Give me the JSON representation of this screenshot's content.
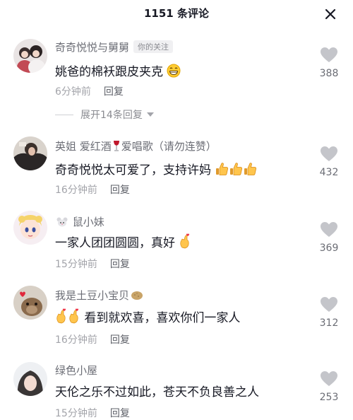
{
  "header": {
    "title": "1151 条评论"
  },
  "expand_label": "展开14条回复",
  "reply_label": "回复",
  "author_tag": "你的关注",
  "comments": [
    {
      "user": "奇奇悦悦与舅舅",
      "text": "姚爸的棉袄跟皮夹克",
      "time": "6分钟前",
      "likes": "388",
      "emojis": [
        "grin-emoji"
      ]
    },
    {
      "user_a": "英姐 爱红酒",
      "user_b": "爱唱歌（请勿连赞）",
      "text": "奇奇悦悦太可爱了，支持许妈",
      "time": "16分钟前",
      "likes": "432",
      "emojis": [
        "thumbs-up-emoji",
        "thumbs-up-emoji",
        "thumbs-up-emoji"
      ]
    },
    {
      "user": "鼠小妹",
      "text": "一家人团团圆圆，真好",
      "time": "15分钟前",
      "likes": "369",
      "emojis": [
        "finger-heart-emoji"
      ]
    },
    {
      "user": "我是土豆小宝贝",
      "text": "看到就欢喜，喜欢你们一家人",
      "time": "16分钟前",
      "likes": "312",
      "emojis": [
        "finger-heart-emoji",
        "finger-heart-emoji"
      ]
    },
    {
      "user": "绿色小屋",
      "text": "天伦之乐不过如此，苍天不负良善之人",
      "time": "15分钟前",
      "likes": "253",
      "emojis": []
    }
  ],
  "colors": {
    "text": "#161823",
    "secondary": "#6b6d75",
    "muted": "#a3a4aa",
    "heart": "#c4c5ca"
  }
}
